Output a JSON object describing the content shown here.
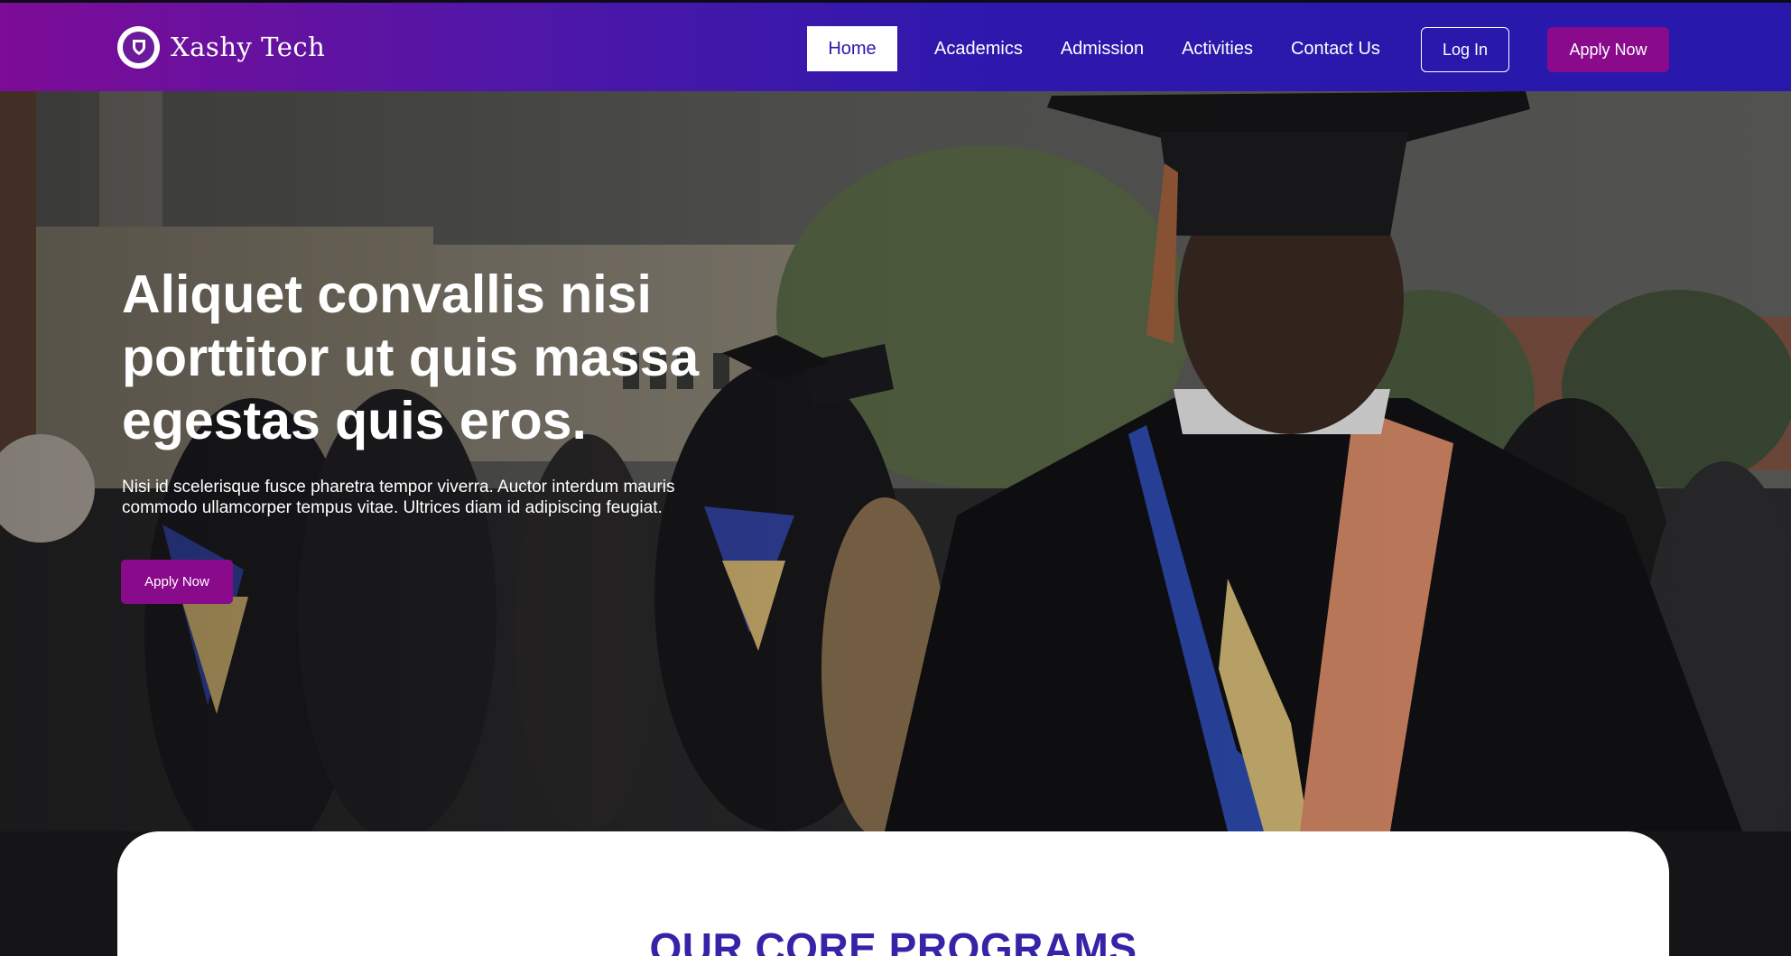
{
  "header": {
    "brand_name": "Xashy Tech",
    "nav": [
      {
        "label": "Home",
        "active": true
      },
      {
        "label": "Academics",
        "active": false
      },
      {
        "label": "Admission",
        "active": false
      },
      {
        "label": "Activities",
        "active": false
      },
      {
        "label": "Contact Us",
        "active": false
      }
    ],
    "login_label": "Log In",
    "apply_label": "Apply Now"
  },
  "hero": {
    "title": "Aliquet convallis nisi porttitor ut quis massa egestas quis eros.",
    "text": "Nisi id scelerisque fusce pharetra tempor viverra. Auctor interdum mauris commodo ullamcorper tempus vitae. Ultrices diam id adipiscing feugiat.",
    "apply_label": "Apply Now",
    "image": "graduation-ceremony-photo"
  },
  "programs": {
    "title": "OUR CORE PROGRAMS"
  },
  "colors": {
    "gradient_start": "#7d0c97",
    "gradient_end": "#2718ab",
    "accent": "#8a0a8c",
    "heading_blue": "#3524a8"
  }
}
